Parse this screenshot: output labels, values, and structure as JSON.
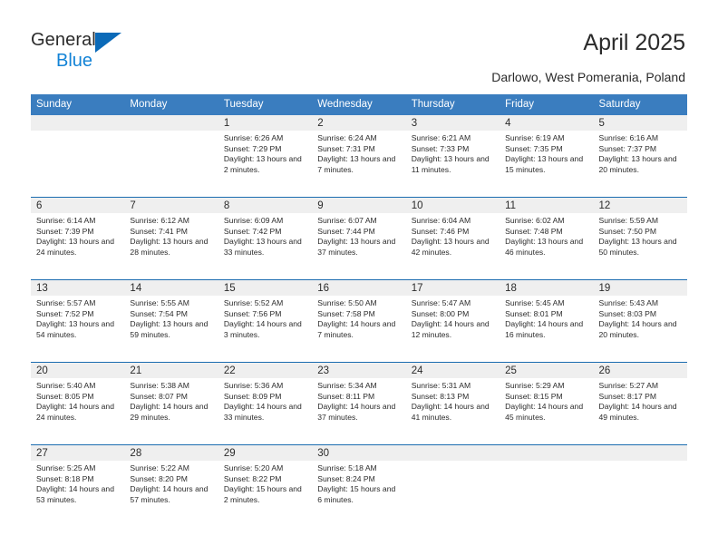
{
  "brand": {
    "name_part1": "General",
    "name_part2": "Blue",
    "accent_color": "#1383d6",
    "triangle_color": "#0b6ab8"
  },
  "header": {
    "title": "April 2025",
    "subtitle": "Darlowo, West Pomerania, Poland"
  },
  "calendar": {
    "header_bg": "#3a7dbf",
    "daynum_bg": "#efefef",
    "separator_color": "#1b6cb0",
    "weekdays": [
      "Sunday",
      "Monday",
      "Tuesday",
      "Wednesday",
      "Thursday",
      "Friday",
      "Saturday"
    ],
    "weeks": [
      [
        {
          "day": "",
          "sunrise": "",
          "sunset": "",
          "daylight": "",
          "empty": true
        },
        {
          "day": "",
          "sunrise": "",
          "sunset": "",
          "daylight": "",
          "empty": true
        },
        {
          "day": "1",
          "sunrise": "Sunrise: 6:26 AM",
          "sunset": "Sunset: 7:29 PM",
          "daylight": "Daylight: 13 hours and 2 minutes."
        },
        {
          "day": "2",
          "sunrise": "Sunrise: 6:24 AM",
          "sunset": "Sunset: 7:31 PM",
          "daylight": "Daylight: 13 hours and 7 minutes."
        },
        {
          "day": "3",
          "sunrise": "Sunrise: 6:21 AM",
          "sunset": "Sunset: 7:33 PM",
          "daylight": "Daylight: 13 hours and 11 minutes."
        },
        {
          "day": "4",
          "sunrise": "Sunrise: 6:19 AM",
          "sunset": "Sunset: 7:35 PM",
          "daylight": "Daylight: 13 hours and 15 minutes."
        },
        {
          "day": "5",
          "sunrise": "Sunrise: 6:16 AM",
          "sunset": "Sunset: 7:37 PM",
          "daylight": "Daylight: 13 hours and 20 minutes."
        }
      ],
      [
        {
          "day": "6",
          "sunrise": "Sunrise: 6:14 AM",
          "sunset": "Sunset: 7:39 PM",
          "daylight": "Daylight: 13 hours and 24 minutes."
        },
        {
          "day": "7",
          "sunrise": "Sunrise: 6:12 AM",
          "sunset": "Sunset: 7:41 PM",
          "daylight": "Daylight: 13 hours and 28 minutes."
        },
        {
          "day": "8",
          "sunrise": "Sunrise: 6:09 AM",
          "sunset": "Sunset: 7:42 PM",
          "daylight": "Daylight: 13 hours and 33 minutes."
        },
        {
          "day": "9",
          "sunrise": "Sunrise: 6:07 AM",
          "sunset": "Sunset: 7:44 PM",
          "daylight": "Daylight: 13 hours and 37 minutes."
        },
        {
          "day": "10",
          "sunrise": "Sunrise: 6:04 AM",
          "sunset": "Sunset: 7:46 PM",
          "daylight": "Daylight: 13 hours and 42 minutes."
        },
        {
          "day": "11",
          "sunrise": "Sunrise: 6:02 AM",
          "sunset": "Sunset: 7:48 PM",
          "daylight": "Daylight: 13 hours and 46 minutes."
        },
        {
          "day": "12",
          "sunrise": "Sunrise: 5:59 AM",
          "sunset": "Sunset: 7:50 PM",
          "daylight": "Daylight: 13 hours and 50 minutes."
        }
      ],
      [
        {
          "day": "13",
          "sunrise": "Sunrise: 5:57 AM",
          "sunset": "Sunset: 7:52 PM",
          "daylight": "Daylight: 13 hours and 54 minutes."
        },
        {
          "day": "14",
          "sunrise": "Sunrise: 5:55 AM",
          "sunset": "Sunset: 7:54 PM",
          "daylight": "Daylight: 13 hours and 59 minutes."
        },
        {
          "day": "15",
          "sunrise": "Sunrise: 5:52 AM",
          "sunset": "Sunset: 7:56 PM",
          "daylight": "Daylight: 14 hours and 3 minutes."
        },
        {
          "day": "16",
          "sunrise": "Sunrise: 5:50 AM",
          "sunset": "Sunset: 7:58 PM",
          "daylight": "Daylight: 14 hours and 7 minutes."
        },
        {
          "day": "17",
          "sunrise": "Sunrise: 5:47 AM",
          "sunset": "Sunset: 8:00 PM",
          "daylight": "Daylight: 14 hours and 12 minutes."
        },
        {
          "day": "18",
          "sunrise": "Sunrise: 5:45 AM",
          "sunset": "Sunset: 8:01 PM",
          "daylight": "Daylight: 14 hours and 16 minutes."
        },
        {
          "day": "19",
          "sunrise": "Sunrise: 5:43 AM",
          "sunset": "Sunset: 8:03 PM",
          "daylight": "Daylight: 14 hours and 20 minutes."
        }
      ],
      [
        {
          "day": "20",
          "sunrise": "Sunrise: 5:40 AM",
          "sunset": "Sunset: 8:05 PM",
          "daylight": "Daylight: 14 hours and 24 minutes."
        },
        {
          "day": "21",
          "sunrise": "Sunrise: 5:38 AM",
          "sunset": "Sunset: 8:07 PM",
          "daylight": "Daylight: 14 hours and 29 minutes."
        },
        {
          "day": "22",
          "sunrise": "Sunrise: 5:36 AM",
          "sunset": "Sunset: 8:09 PM",
          "daylight": "Daylight: 14 hours and 33 minutes."
        },
        {
          "day": "23",
          "sunrise": "Sunrise: 5:34 AM",
          "sunset": "Sunset: 8:11 PM",
          "daylight": "Daylight: 14 hours and 37 minutes."
        },
        {
          "day": "24",
          "sunrise": "Sunrise: 5:31 AM",
          "sunset": "Sunset: 8:13 PM",
          "daylight": "Daylight: 14 hours and 41 minutes."
        },
        {
          "day": "25",
          "sunrise": "Sunrise: 5:29 AM",
          "sunset": "Sunset: 8:15 PM",
          "daylight": "Daylight: 14 hours and 45 minutes."
        },
        {
          "day": "26",
          "sunrise": "Sunrise: 5:27 AM",
          "sunset": "Sunset: 8:17 PM",
          "daylight": "Daylight: 14 hours and 49 minutes."
        }
      ],
      [
        {
          "day": "27",
          "sunrise": "Sunrise: 5:25 AM",
          "sunset": "Sunset: 8:18 PM",
          "daylight": "Daylight: 14 hours and 53 minutes."
        },
        {
          "day": "28",
          "sunrise": "Sunrise: 5:22 AM",
          "sunset": "Sunset: 8:20 PM",
          "daylight": "Daylight: 14 hours and 57 minutes."
        },
        {
          "day": "29",
          "sunrise": "Sunrise: 5:20 AM",
          "sunset": "Sunset: 8:22 PM",
          "daylight": "Daylight: 15 hours and 2 minutes."
        },
        {
          "day": "30",
          "sunrise": "Sunrise: 5:18 AM",
          "sunset": "Sunset: 8:24 PM",
          "daylight": "Daylight: 15 hours and 6 minutes."
        },
        {
          "day": "",
          "sunrise": "",
          "sunset": "",
          "daylight": "",
          "empty": true
        },
        {
          "day": "",
          "sunrise": "",
          "sunset": "",
          "daylight": "",
          "empty": true
        },
        {
          "day": "",
          "sunrise": "",
          "sunset": "",
          "daylight": "",
          "empty": true
        }
      ]
    ]
  }
}
